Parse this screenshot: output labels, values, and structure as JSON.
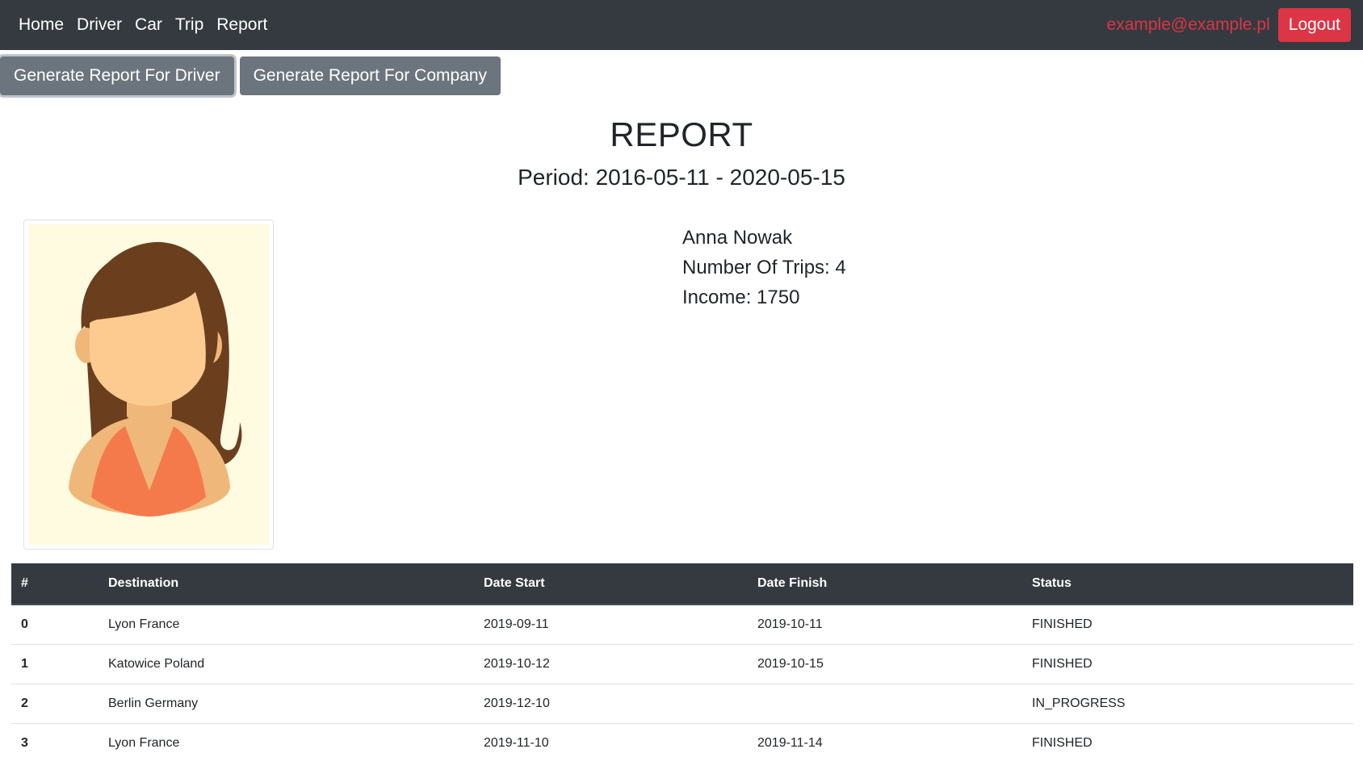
{
  "nav": {
    "links": [
      "Home",
      "Driver",
      "Car",
      "Trip",
      "Report"
    ],
    "user_email": "example@example.pl",
    "logout_label": "Logout"
  },
  "actions": {
    "driver_report_label": "Generate Report For Driver",
    "company_report_label": "Generate Report For Company"
  },
  "report": {
    "title": "REPORT",
    "period": "Period: 2016-05-11 - 2020-05-15",
    "driver_name": "Anna Nowak",
    "trips": "Number Of Trips: 4",
    "income": "Income: 1750",
    "avatar_icon": "female-avatar-icon"
  },
  "table": {
    "headers": [
      "#",
      "Destination",
      "Date Start",
      "Date Finish",
      "Status"
    ],
    "rows": [
      [
        "0",
        "Lyon France",
        "2019-09-11",
        "2019-10-11",
        "FINISHED"
      ],
      [
        "1",
        "Katowice Poland",
        "2019-10-12",
        "2019-10-15",
        "FINISHED"
      ],
      [
        "2",
        "Berlin Germany",
        "2019-12-10",
        "",
        "IN_PROGRESS"
      ],
      [
        "3",
        "Lyon France",
        "2019-11-10",
        "2019-11-14",
        "FINISHED"
      ]
    ]
  },
  "colors": {
    "navbar": "#343a40",
    "danger": "#dc3545",
    "secondary": "#6c757d",
    "avatar_bg": "#fffbe0",
    "hair": "#6b3f1e",
    "skin": "#fdcb8f",
    "shirt": "#f47a4c"
  }
}
